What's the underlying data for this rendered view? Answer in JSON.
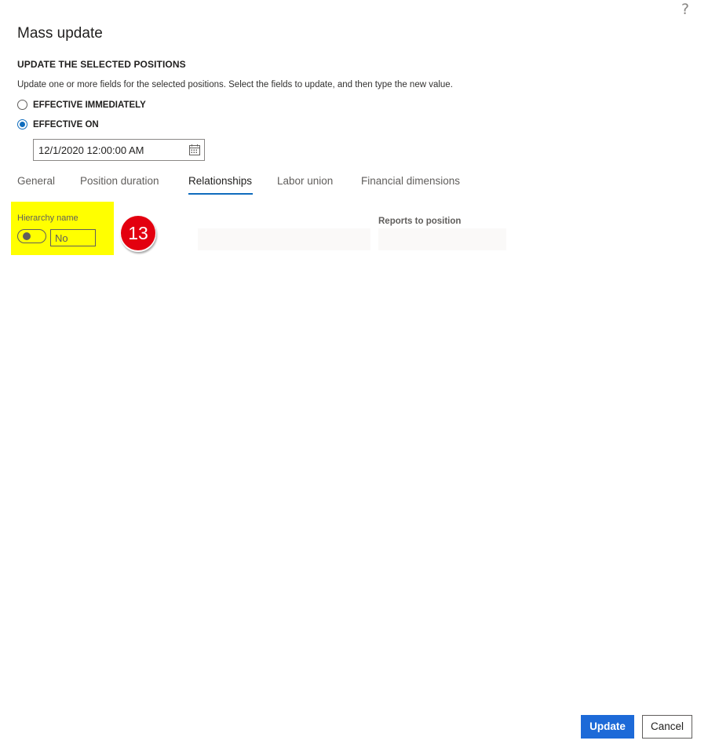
{
  "header": {
    "help_icon": "question-mark-icon",
    "help_glyph": "?",
    "title": "Mass update"
  },
  "section": {
    "heading": "UPDATE THE SELECTED POSITIONS",
    "description": "Update one or more fields for the selected positions. Select the fields to update, and then type the new value."
  },
  "effective": {
    "options": [
      {
        "label": "EFFECTIVE IMMEDIATELY",
        "selected": false
      },
      {
        "label": "EFFECTIVE ON",
        "selected": true
      }
    ],
    "date_value": "12/1/2020 12:00:00 AM",
    "calendar_icon": "calendar-icon"
  },
  "tabs": [
    {
      "label": "General",
      "active": false
    },
    {
      "label": "Position duration",
      "active": false
    },
    {
      "label": "Relationships",
      "active": true
    },
    {
      "label": "Labor union",
      "active": false
    },
    {
      "label": "Financial dimensions",
      "active": false
    }
  ],
  "relationships": {
    "hierarchy_name_label": "Hierarchy name",
    "hierarchy_toggle_value": "No",
    "hierarchy_toggle_on": false,
    "reports_to_label": "Reports to position"
  },
  "annotation": {
    "step_number": "13",
    "color": "#e3000f"
  },
  "footer": {
    "update_label": "Update",
    "cancel_label": "Cancel"
  },
  "colors": {
    "accent": "#0f6cbd",
    "primary_button": "#1d6ad8",
    "highlight": "#ffff00"
  }
}
